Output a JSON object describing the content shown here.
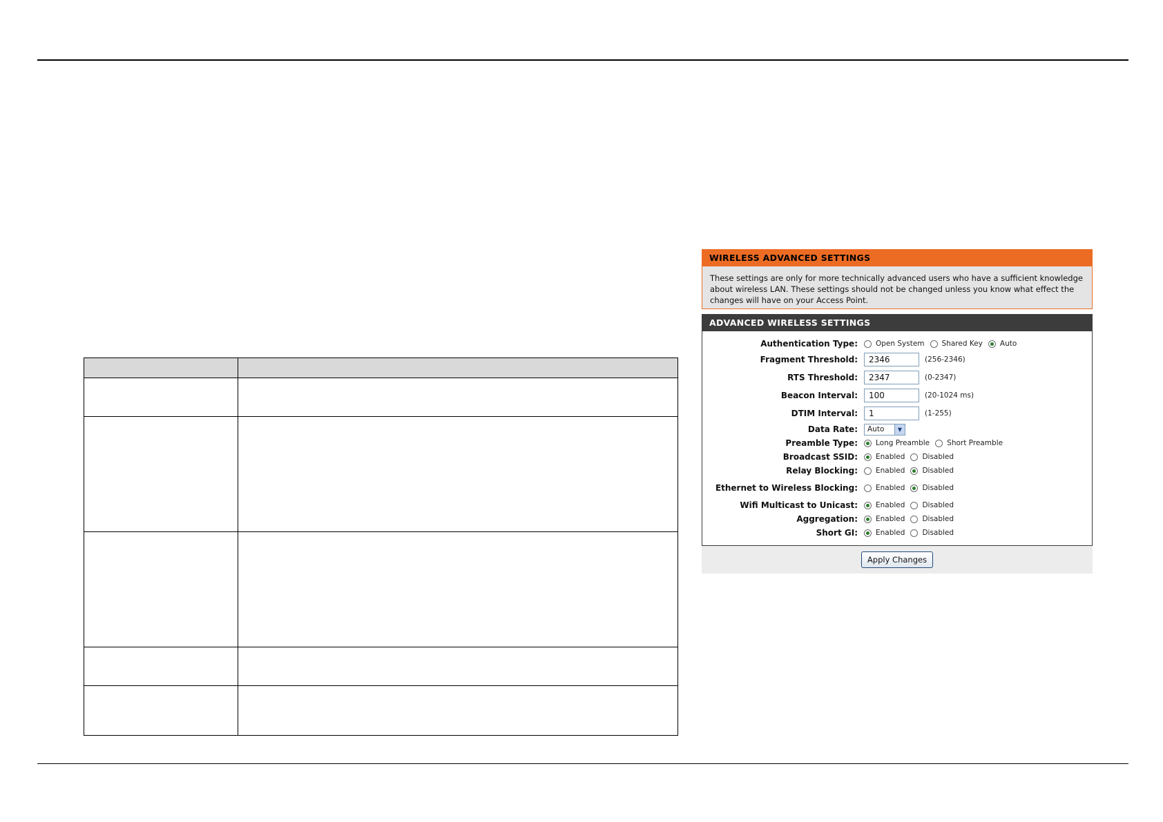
{
  "page": {},
  "panel": {
    "wireless_title": "WIRELESS ADVANCED SETTINGS",
    "notice": "These settings are only for more technically advanced users who have a sufficient knowledge about wireless LAN. These settings should not be changed unless you know what effect the changes will have on your Access Point.",
    "advanced_title": "ADVANCED WIRELESS SETTINGS",
    "auth": {
      "label": "Authentication Type:",
      "opt1": "Open System",
      "opt2": "Shared Key",
      "opt3": "Auto"
    },
    "fragment": {
      "label": "Fragment Threshold:",
      "value": "2346",
      "hint": "(256-2346)"
    },
    "rts": {
      "label": "RTS Threshold:",
      "value": "2347",
      "hint": "(0-2347)"
    },
    "beacon": {
      "label": "Beacon Interval:",
      "value": "100",
      "hint": "(20-1024 ms)"
    },
    "dtim": {
      "label": "DTIM Interval:",
      "value": "1",
      "hint": "(1-255)"
    },
    "datarate": {
      "label": "Data Rate:",
      "value": "Auto"
    },
    "preamble": {
      "label": "Preamble Type:",
      "opt1": "Long Preamble",
      "opt2": "Short Preamble"
    },
    "broadcast": {
      "label": "Broadcast SSID:",
      "opt1": "Enabled",
      "opt2": "Disabled"
    },
    "relay": {
      "label": "Relay Blocking:",
      "opt1": "Enabled",
      "opt2": "Disabled"
    },
    "ethernet": {
      "label": "Ethernet to Wireless Blocking:",
      "opt1": "Enabled",
      "opt2": "Disabled"
    },
    "multicast": {
      "label": "Wifi Multicast to Unicast:",
      "opt1": "Enabled",
      "opt2": "Disabled"
    },
    "aggregation": {
      "label": "Aggregation:",
      "opt1": "Enabled",
      "opt2": "Disabled"
    },
    "shortgi": {
      "label": "Short GI:",
      "opt1": "Enabled",
      "opt2": "Disabled"
    },
    "apply_label": "Apply Changes"
  },
  "colors": {
    "orange": "#ec6c24",
    "dark": "#3c3c3c",
    "radio_dot": "#2a7d2a"
  }
}
